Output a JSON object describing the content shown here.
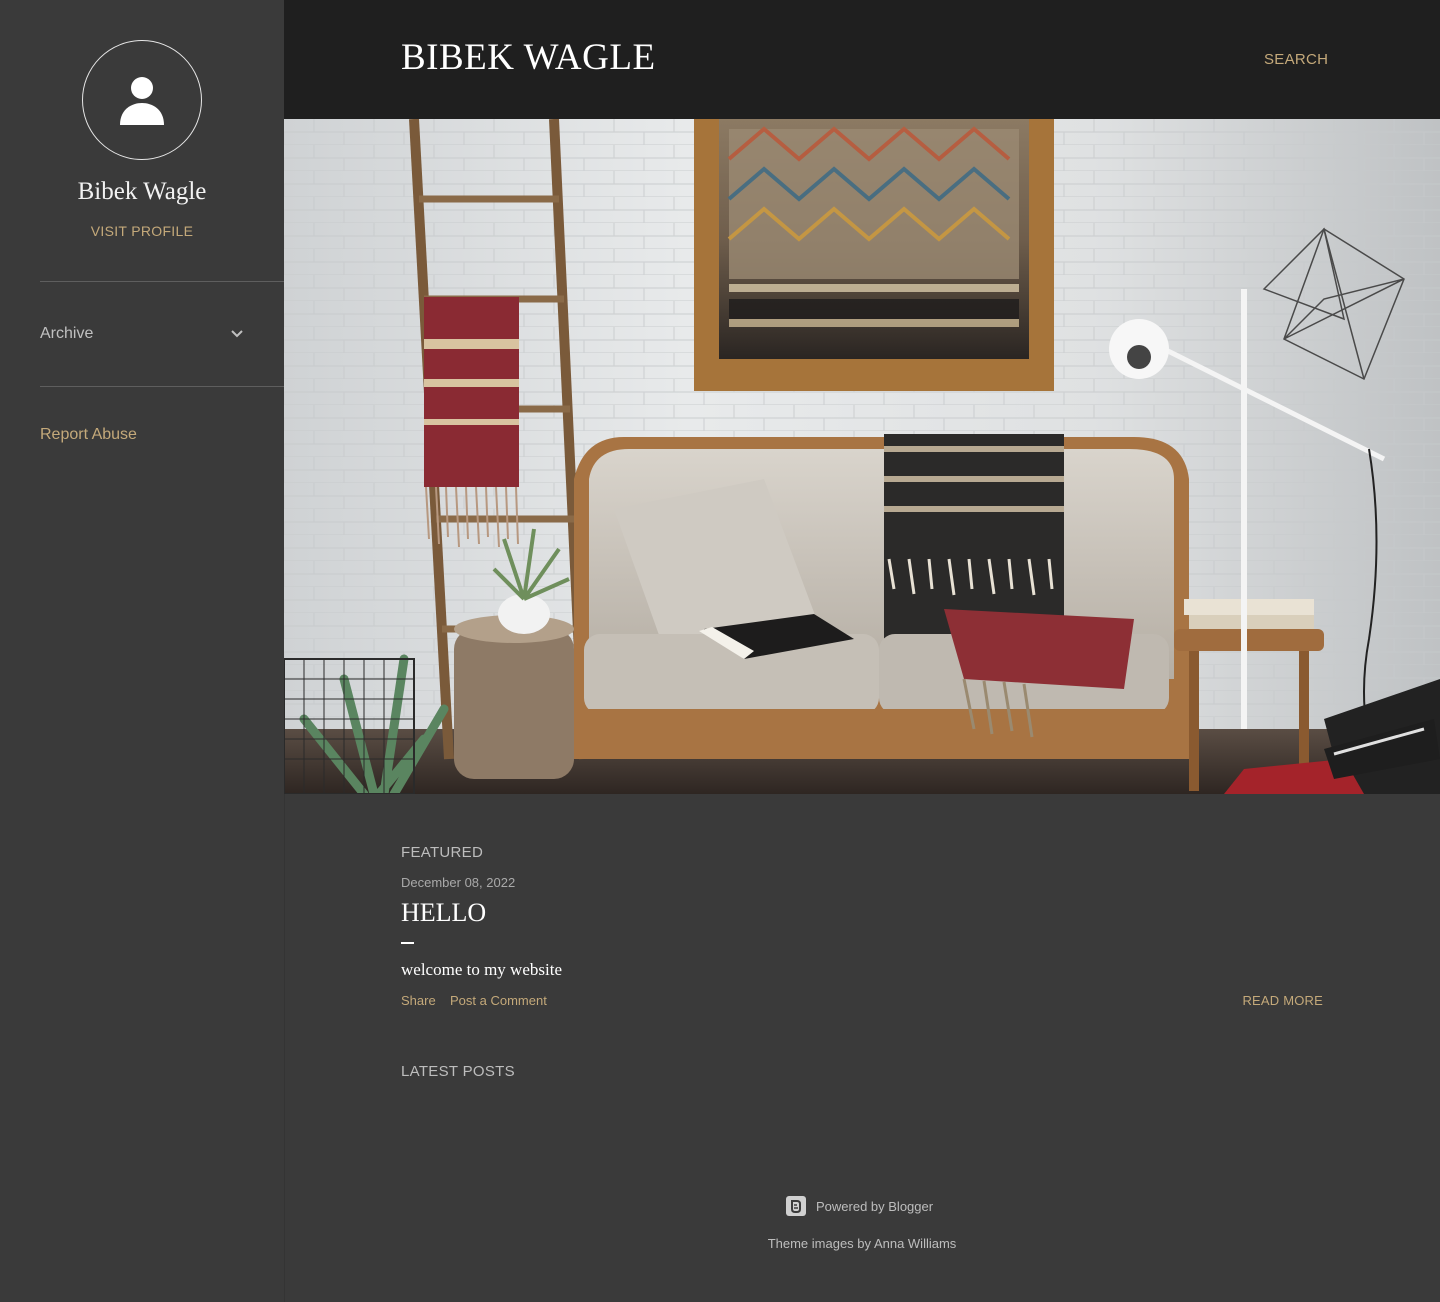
{
  "sidebar": {
    "profile_name": "Bibek Wagle",
    "visit_profile": "Visit profile",
    "archive_label": "Archive",
    "report_abuse": "Report Abuse"
  },
  "header": {
    "blog_title": "Bibek Wagle",
    "search_label": "Search"
  },
  "main": {
    "featured_label": "Featured",
    "post": {
      "date": "December 08, 2022",
      "title": "Hello",
      "snippet": "welcome to my website",
      "share_label": "Share",
      "comment_label": "Post a Comment",
      "read_more": "Read more"
    },
    "latest_posts_label": "Latest posts"
  },
  "footer": {
    "powered_by": "Powered by Blogger",
    "theme_credit_prefix": "Theme images by",
    "theme_credit_author": "Anna Williams"
  },
  "colors": {
    "accent": "#c4a97a",
    "background": "#3a3a3a",
    "header_bg": "#1f1f1f"
  },
  "icons": [
    "person-icon",
    "chevron-down-icon",
    "blogger-icon"
  ]
}
